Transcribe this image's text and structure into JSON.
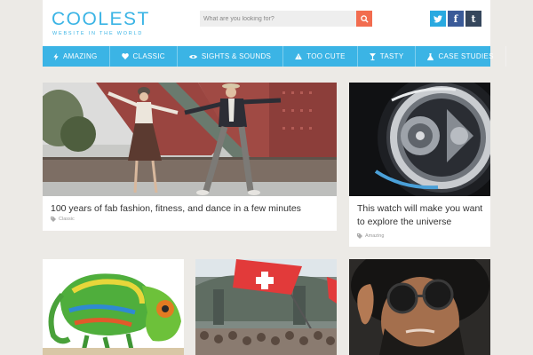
{
  "header": {
    "logo_title": "COOLEST",
    "logo_subtitle": "WEBSITE IN THE WORLD",
    "search_placeholder": "What are you looking for?",
    "social": [
      "twitter",
      "facebook",
      "tumblr"
    ],
    "social_glyphs": {
      "twitter": "t",
      "facebook": "f",
      "tumblr": "t"
    }
  },
  "nav": {
    "items": [
      {
        "label": "AMAZING",
        "icon": "lightning-icon"
      },
      {
        "label": "CLASSIC",
        "icon": "heart-icon"
      },
      {
        "label": "SIGHTS & SOUNDS",
        "icon": "eye-icon"
      },
      {
        "label": "TOO CUTE",
        "icon": "warning-icon"
      },
      {
        "label": "TASTY",
        "icon": "cocktail-icon"
      },
      {
        "label": "CASE STUDIES",
        "icon": "flask-icon"
      }
    ]
  },
  "cards": [
    {
      "title": "100 years of fab fashion, fitness, and dance in a few minutes",
      "tag": "Classic"
    },
    {
      "title": "This watch will make you want to explore the universe",
      "tag": "Amazing"
    },
    {
      "title": "",
      "tag": ""
    },
    {
      "title": "",
      "tag": ""
    },
    {
      "title": "",
      "tag": ""
    }
  ],
  "colors": {
    "accent": "#3bb4e5",
    "search_button": "#f26c4f",
    "twitter": "#29a9e0",
    "facebook": "#3a5a98",
    "tumblr": "#35465c",
    "background": "#eceae6"
  }
}
